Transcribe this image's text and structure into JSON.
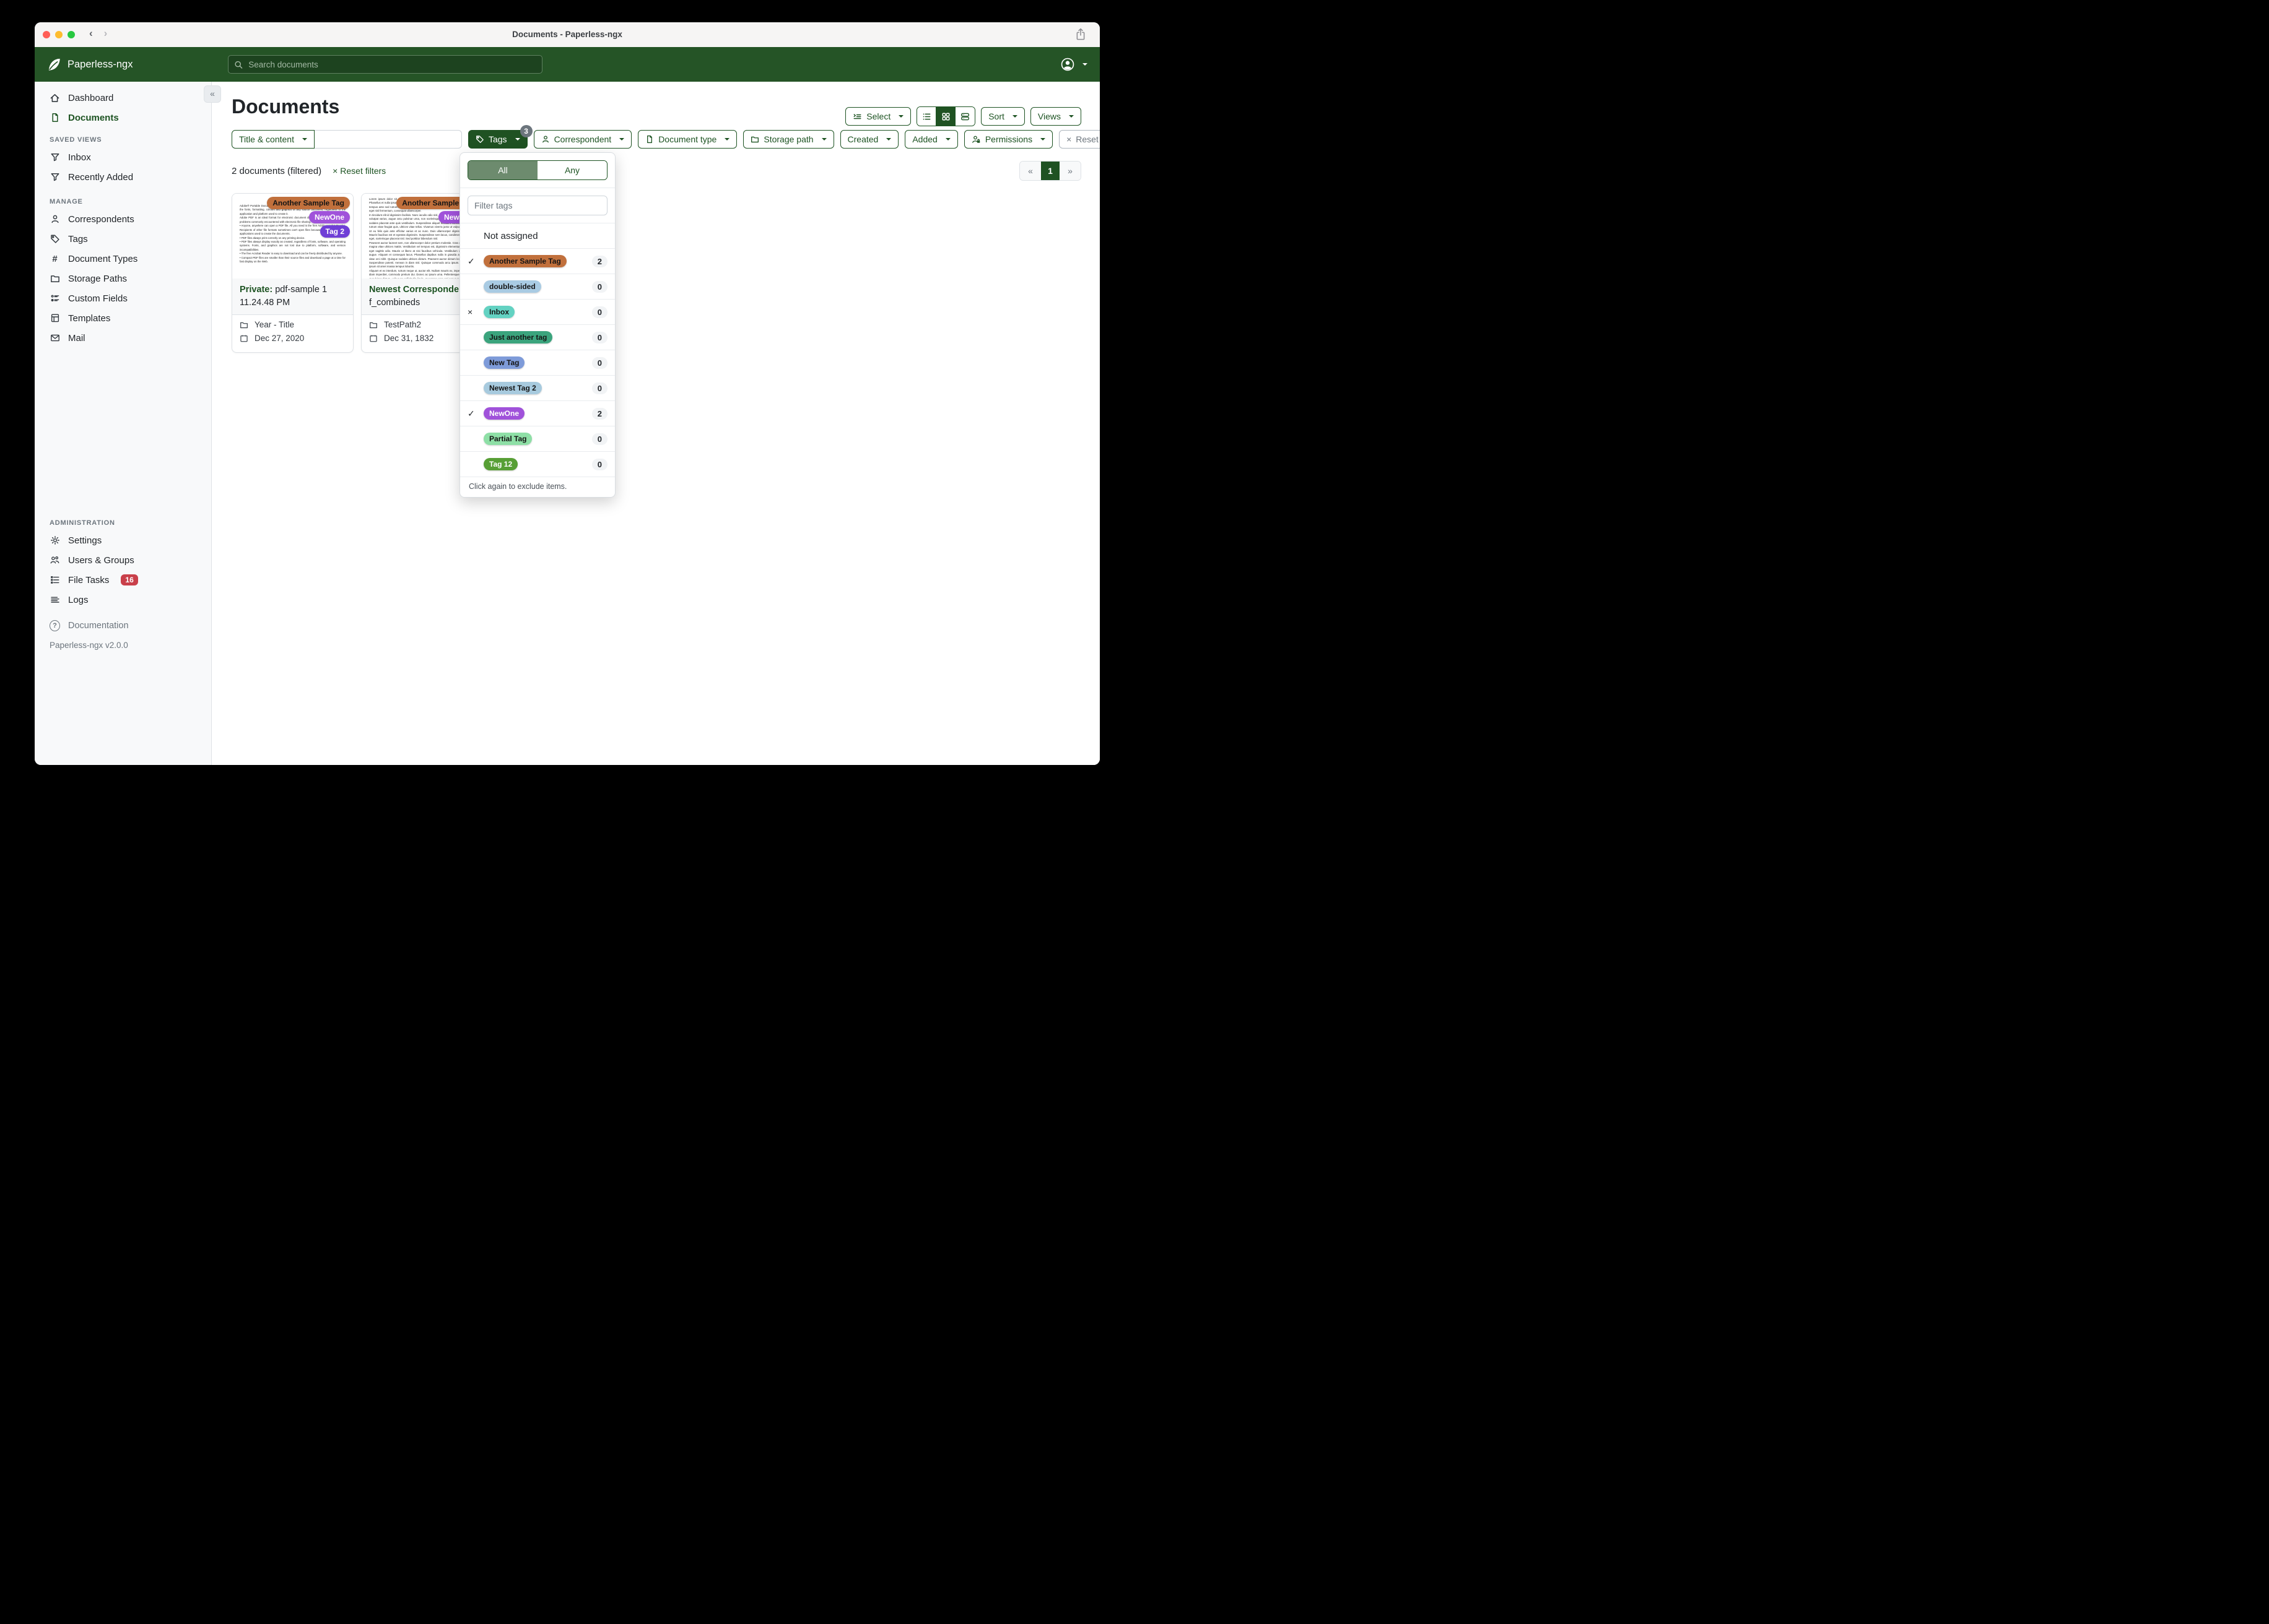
{
  "colors": {
    "navbar_green": "#255426",
    "brand_green": "#1d5322",
    "solid_button_green": "#1f5222",
    "segmented_selected": "#6d8b6e",
    "badge_grey": "#6c757d",
    "file_tasks_red": "#c9404a",
    "traffic_red": "#ff5f57",
    "traffic_yellow": "#febc2e",
    "traffic_green": "#28c840"
  },
  "titlebar": {
    "title": "Documents - Paperless-ngx"
  },
  "navbar": {
    "brand": "Paperless-ngx",
    "search_placeholder": "Search documents"
  },
  "sidebar": {
    "dashboard": "Dashboard",
    "documents": "Documents",
    "saved_views_header": "SAVED VIEWS",
    "inbox": "Inbox",
    "recently_added": "Recently Added",
    "manage_header": "MANAGE",
    "correspondents": "Correspondents",
    "tags": "Tags",
    "document_types": "Document Types",
    "storage_paths": "Storage Paths",
    "custom_fields": "Custom Fields",
    "templates": "Templates",
    "mail": "Mail",
    "admin_header": "ADMINISTRATION",
    "settings": "Settings",
    "users_groups": "Users & Groups",
    "file_tasks": "File Tasks",
    "file_tasks_count": "16",
    "logs": "Logs",
    "documentation": "Documentation",
    "version": "Paperless-ngx v2.0.0"
  },
  "header": {
    "title": "Documents",
    "select": "Select",
    "sort": "Sort",
    "views": "Views"
  },
  "filters": {
    "field_selector": "Title & content",
    "input_value": "",
    "tags": "Tags",
    "tags_badge": "3",
    "correspondent": "Correspondent",
    "document_type": "Document type",
    "storage_path": "Storage path",
    "created": "Created",
    "added": "Added",
    "permissions": "Permissions",
    "reset": "Reset filters"
  },
  "status": {
    "count": "2 documents (filtered)",
    "reset": "Reset filters",
    "reset_x": "×"
  },
  "pagination": {
    "prev": "«",
    "page": "1",
    "next": "»"
  },
  "collapse_glyph": "«",
  "tags_dropdown": {
    "all": "All",
    "any": "Any",
    "filter_placeholder": "Filter tags",
    "not_assigned": "Not assigned",
    "footer": "Click again to exclude items.",
    "items": [
      {
        "label": "Another Sample Tag",
        "count": "2",
        "mark": "✓",
        "bg": "#c1703c",
        "fg": "#151515"
      },
      {
        "label": "double-sided",
        "count": "0",
        "mark": "",
        "bg": "#a9cbe3",
        "fg": "#151515"
      },
      {
        "label": "Inbox",
        "count": "0",
        "mark": "×",
        "bg": "#63d2c2",
        "fg": "#151515"
      },
      {
        "label": "Just another tag",
        "count": "0",
        "mark": "",
        "bg": "#3ba47d",
        "fg": "#151515"
      },
      {
        "label": "New Tag",
        "count": "0",
        "mark": "",
        "bg": "#7e9bd9",
        "fg": "#151515"
      },
      {
        "label": "Newest Tag 2",
        "count": "0",
        "mark": "",
        "bg": "#a7cade",
        "fg": "#151515"
      },
      {
        "label": "NewOne",
        "count": "2",
        "mark": "✓",
        "bg": "#a052da",
        "fg": "#ffffff"
      },
      {
        "label": "Partial Tag",
        "count": "0",
        "mark": "",
        "bg": "#8edfa6",
        "fg": "#151515"
      },
      {
        "label": "Tag 12",
        "count": "0",
        "mark": "",
        "bg": "#579f35",
        "fg": "#ffffff"
      }
    ]
  },
  "cards": [
    {
      "tags": [
        {
          "label": "Another Sample Tag",
          "bg": "#c1703c",
          "fg": "#151515"
        },
        {
          "label": "NewOne",
          "bg": "#a052da",
          "fg": "#ffffff"
        },
        {
          "label": "Tag 2",
          "bg": "#6f3fd6",
          "fg": "#ffffff"
        }
      ],
      "title_prefix": "Private:",
      "title_rest": " pdf-sample 1 11.24.48 PM",
      "path": "Year - Title",
      "date": "Dec 27, 2020",
      "thumb": {
        "heading": "Adobe Acrobat PDF Files",
        "body": "Adobe® Portable Document Format (PDF) is a universal file format that preserves all of the fonts, formatting, colours and graphics of any source document, regardless of the application and platform used to create it.\nAdobe PDF is an ideal format for electronic document distribution as it overcomes the problems commonly encountered with electronic file sharing.\n•  Anyone, anywhere can open a PDF file. All you need is the free Adobe Acrobat Reader. Recipients of other file formats sometimes can't open files because they don't have the applications used to create the documents.\n•  PDF files always print correctly on any printing device.\n•  PDF files always display exactly as created, regardless of fonts, software, and operating systems. Fonts, and graphics are not lost due to platform, software, and version incompatibilities.\n•  The free Acrobat Reader is easy to download and can be freely distributed by anyone.\n•  Compact PDF files are smaller than their source files and download a page at a time for fast display on the Web."
      }
    },
    {
      "tags": [
        {
          "label": "Another Sample Tag",
          "bg": "#c1703c",
          "fg": "#151515"
        },
        {
          "label": "NewOne",
          "bg": "#a052da",
          "fg": "#ffffff"
        }
      ],
      "title_prefix": "Newest Correspondent:",
      "title_rest": " f_combineds",
      "path": "TestPath2",
      "date": "Dec 31, 1832",
      "thumb": {
        "heading": "",
        "body": "Lorem ipsum dolor sit amet, consectetur adipiscing elit. Aenean vitae fringilla nunc. Phasellus et nulla ipsum. Vestibulum quis ex lacus. Mauris sit amet mi a lacus fermentum tempus ante sed rutrum. Aenean et magna elementum, tincidunt turpis. Ut eleifend urna eget nisl fermentum, consequat ullamcorper.\nIn tincidunt elit id dignissim facilisis. Nunc iaculis odio nisl, sit amet vestibulum, ipsum vel volutpat varius, augue arcu pulvinar urna, non scelerisque augue justo vel enim. Proin sodales placerat ante quis vestibulum. Suspendisse aliquet tincidunt cursus. Nam mi ex, rutrum vitae feugiat quis, ultrices vitae tellus. Vivamus viverra justo ut vulputate rhoncus. Ut eu felis quis ante efficitur varius et ac nunc. Duis ullamcorper dignissim posuere. Mauris faucibus est et egestas dignissim. Suspendisse sem lacus, condimentum in libero eget, scelerisque placerat nisl. Sed porttitor bibendum nisl.\nPraesent auctor laoreet sem, non ullamcorper dolor pretium molestie. Cras condimentum magna vitae ultrices mattis. Vestibulum vel tempus est, dignissim elementum sem. Nunc eget sagittis odio. Mauris ut libero at nisi faucibus vehicula. Vestibulum vitae eleifend augue. Aliquam et consequat lacus. Phasellus dapibus nulla in gravida auctor. Mauris vitae orci nibh. Quisque sodales ultrices dictum. Praesent auctor dictum leo nec aliquet. Suspendisse potenti. Aenean in diam nisl. Quisque commodo arcu ipsum. Proin iaculis ipsum sit amet massa tempus lobortis.\nAliquam et ex interdum, rutrum neque ut, auctor elit. Nullam mauris ex, imperdiet sit amet diam imperdiet, commodo pretium dui. Donec ac ipsum urna. Pellentesque dapibus, est ut pulvinar dictum, velit nunc sollicitudin ligula, at semper eros orci non nunc. Aliquam sit amet vulputate sapien, quis tincidunt eros. Nam quis tincidunt lorem. In tempus ornare dui at porttitor.\nCurabitur eu enim orci. Vestibulum consequat eros quis sollicitudin tincidunt. Sed arcu est, laoreet quis temper et, posuere et est. Cras tincidunt lacus erat, sit amet aliquam enim consectetur nec. Aenean scelerisque rutrum elit sed lobortis. Morbi malesuada aliquam arcu, sit amet egestas neque aliquam ut. Sed dui mi, feugiat a risus sit amet, posuere placerat orci."
      }
    }
  ]
}
